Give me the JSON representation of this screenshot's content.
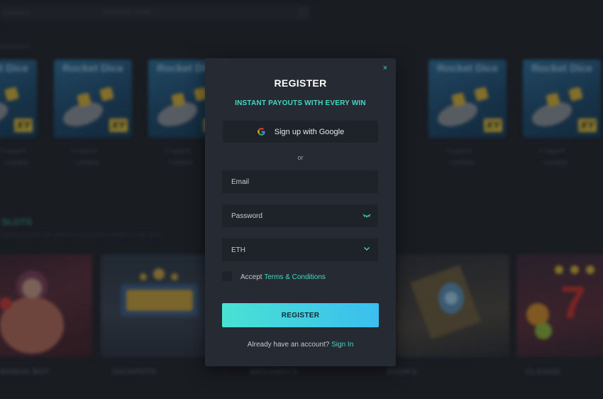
{
  "background": {
    "top_field": {
      "left_text": "xxxxxxxxxx",
      "right_text": "FIND RYNC GAME"
    },
    "section_small": "WINNERS",
    "cards": [
      {
        "title": "Rocket Dice",
        "badge": "XY",
        "user": "Rrxgggre8",
        "amount": "~ 0.003523"
      },
      {
        "title": "Rocket Dice",
        "badge": "XY",
        "user": "Rrxgggre8",
        "amount": "~ 0.003523"
      },
      {
        "title": "Rocket Dice",
        "badge": "XY",
        "user": "Rrxgggre8",
        "amount": "~ 0.003523"
      },
      {
        "title": "Rocket Dice",
        "badge": "XY",
        "user": "Rrxgggre8",
        "amount": "~ 0.003523"
      },
      {
        "title": "Rocket Dice",
        "badge": "XY",
        "user": "Rrxgggre8",
        "amount": "~ 0.003523"
      }
    ],
    "slots_title": "SLOTS",
    "slots_subtitle": "Explore popular slot games from the best providers in one place",
    "categories": [
      "BONUS BUY",
      "JACKPOTS",
      "MEGAWAYS",
      "BOOKS",
      "CLASSIC"
    ]
  },
  "modal": {
    "title": "REGISTER",
    "subtitle": "INSTANT PAYOUTS WITH EVERY WIN",
    "close_icon": "×",
    "google_button": "Sign up with Google",
    "or_text": "or",
    "email_placeholder": "Email",
    "password_placeholder": "Password",
    "currency_value": "ETH",
    "accept_text": "Accept",
    "terms_link": "Terms & Conditions",
    "register_button": "REGISTER",
    "already_text": "Already have an account?",
    "signin_link": "Sign In"
  },
  "colors": {
    "accent": "#45d6c5",
    "button_gradient_start": "#49e2d4",
    "button_gradient_end": "#3bbeee",
    "modal_bg": "#262b33",
    "field_bg": "#1e2229",
    "page_bg": "#1f232a"
  },
  "icons": {
    "close": "close-icon",
    "google": "google-icon",
    "password_toggle": "eye-icon",
    "currency_dropdown": "chevron-down-icon"
  }
}
